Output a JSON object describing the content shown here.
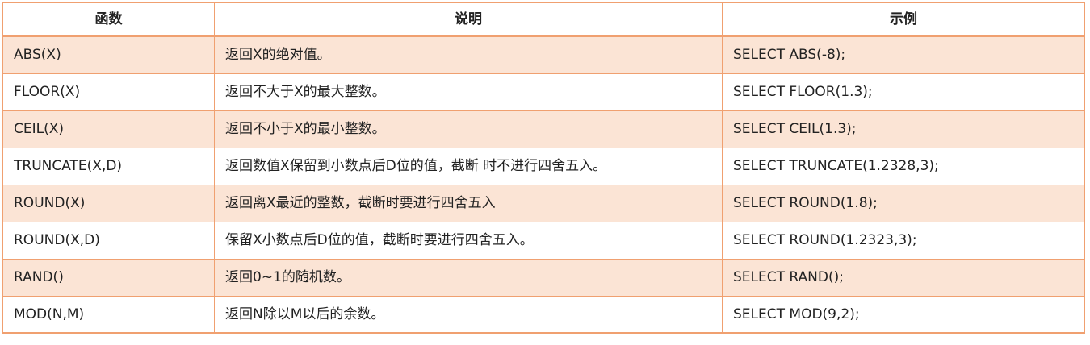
{
  "table": {
    "headers": [
      "函数",
      "说明",
      "示例"
    ],
    "rows": [
      [
        "ABS(X)",
        "返回X的绝对值。",
        "SELECT ABS(-8);"
      ],
      [
        "FLOOR(X)",
        "返回不大于X的最大整数。",
        "SELECT FLOOR(1.3);"
      ],
      [
        "CEIL(X)",
        "返回不小于X的最小整数。",
        "SELECT CEIL(1.3);"
      ],
      [
        "TRUNCATE(X,D)",
        "返回数值X保留到小数点后D位的值，截断 时不进行四舍五入。",
        "SELECT TRUNCATE(1.2328,3);"
      ],
      [
        "ROUND(X)",
        "返回离X最近的整数，截断时要进行四舍五入",
        "SELECT ROUND(1.8);"
      ],
      [
        "ROUND(X,D)",
        "保留X小数点后D位的值，截断时要进行四舍五入。",
        "SELECT ROUND(1.2323,3);"
      ],
      [
        "RAND()",
        "返回0~1的随机数。",
        "SELECT RAND();"
      ],
      [
        "MOD(N,M)",
        "返回N除以M以后的余数。",
        "SELECT MOD(9,2);"
      ]
    ]
  },
  "colors": {
    "border": "#f0a070",
    "band": "#fbe4d5"
  }
}
